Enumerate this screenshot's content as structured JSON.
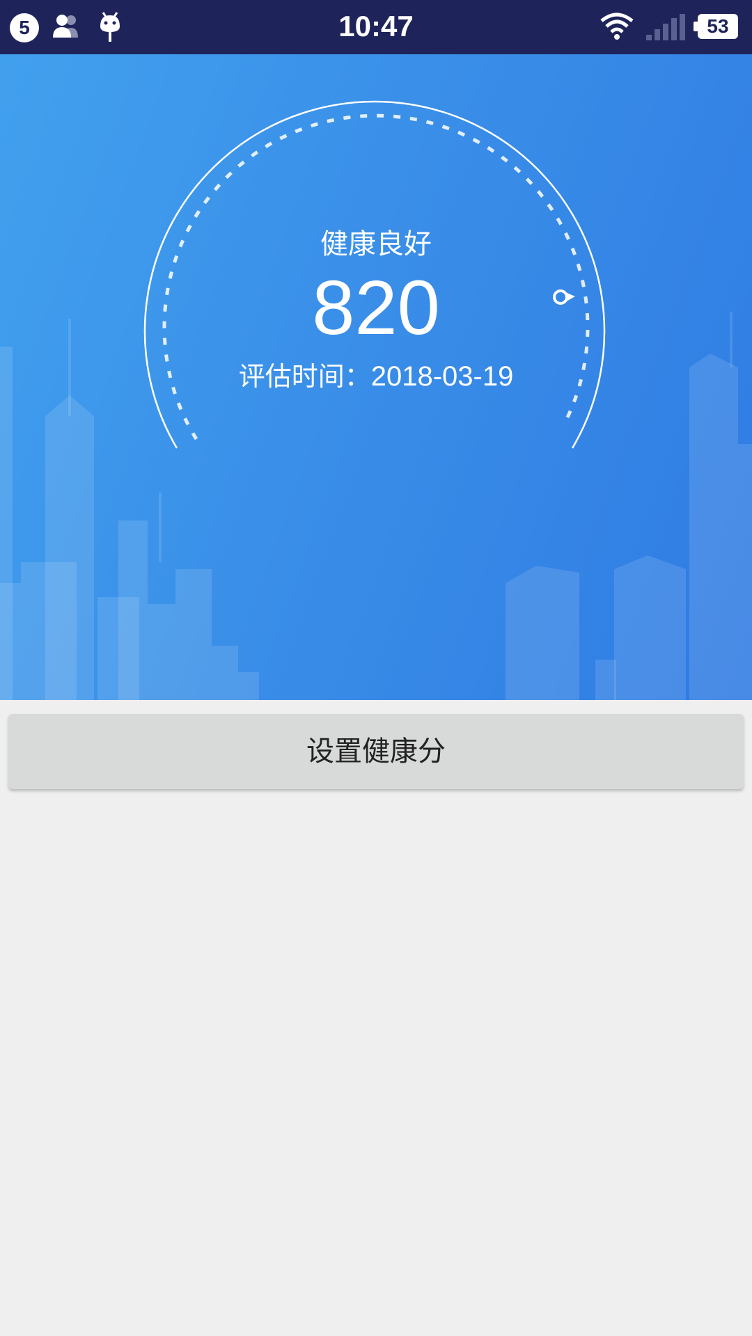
{
  "status_bar": {
    "notification_count": "5",
    "time": "10:47",
    "battery_level": "53",
    "icons": [
      "contacts-icon",
      "android-debug-icon",
      "wifi-icon",
      "cell-signal-icon",
      "battery-icon"
    ]
  },
  "health": {
    "status": "健康良好",
    "score": "820",
    "eval_label": "评估时间：",
    "eval_date": "2018-03-19"
  },
  "actions": {
    "set_score_label": "设置健康分"
  },
  "colors": {
    "status_bar_bg": "#1e245a",
    "hero_start": "#41a0ee",
    "hero_end": "#2f7be3",
    "page_bg": "#efeff0",
    "button_bg": "#d8d9d9"
  }
}
